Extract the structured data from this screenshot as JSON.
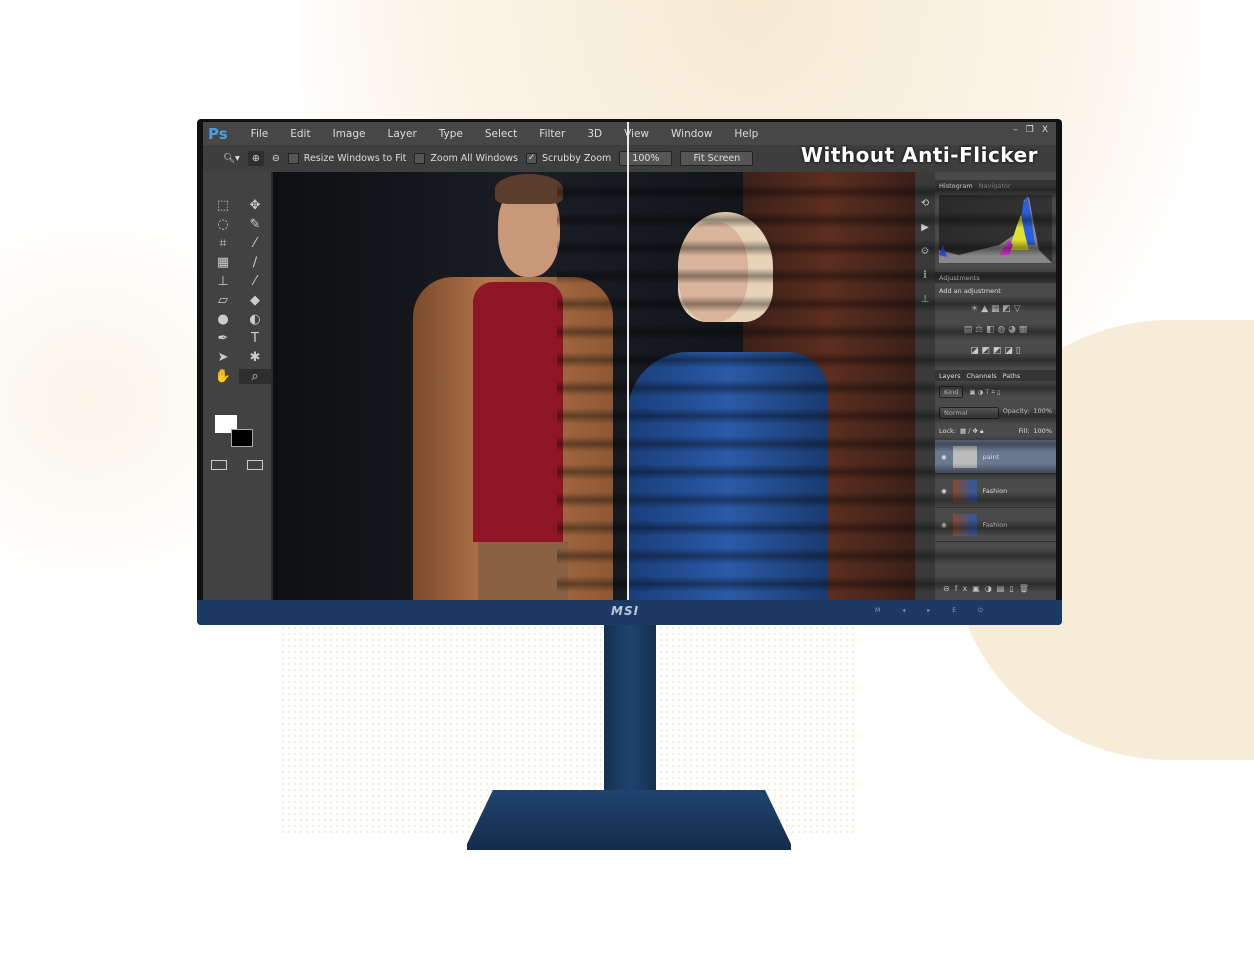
{
  "headline": "Without Anti-Flicker",
  "brand": "MSI",
  "app": {
    "logo": "Ps",
    "menu": [
      "File",
      "Edit",
      "Image",
      "Layer",
      "Type",
      "Select",
      "Filter",
      "3D",
      "View",
      "Window",
      "Help"
    ],
    "window_controls": [
      "–",
      "❐",
      "X"
    ]
  },
  "options": {
    "resize_windows": "Resize Windows to Fit",
    "zoom_all": "Zoom All Windows",
    "scrubby_zoom": "Scrubby Zoom",
    "zoom_value": "100%",
    "fit_screen": "Fit Screen",
    "resize_checked": false,
    "zoom_all_checked": false,
    "scrubby_checked": true
  },
  "panels": {
    "histogram_tabs": [
      "Histogram",
      "Navigator"
    ],
    "adjustments_tab": "Adjustments",
    "adjustments_hint": "Add an adjustment",
    "layers_tabs": [
      "Layers",
      "Channels",
      "Paths"
    ],
    "kind": "Kind",
    "blend_mode": "Normal",
    "opacity_label": "Opacity:",
    "opacity": "100%",
    "lock_label": "Lock:",
    "fill_label": "Fill:",
    "fill": "100%",
    "layers": [
      {
        "name": "paint",
        "selected": true
      },
      {
        "name": "Fashion",
        "selected": false
      },
      {
        "name": "Fashion",
        "selected": false
      }
    ]
  },
  "bezel_buttons": [
    "M",
    "◂",
    "▸",
    "E",
    "⏻"
  ],
  "colors": {
    "bezel": "#1c3a63",
    "ps_blue": "#4b9fe0"
  }
}
